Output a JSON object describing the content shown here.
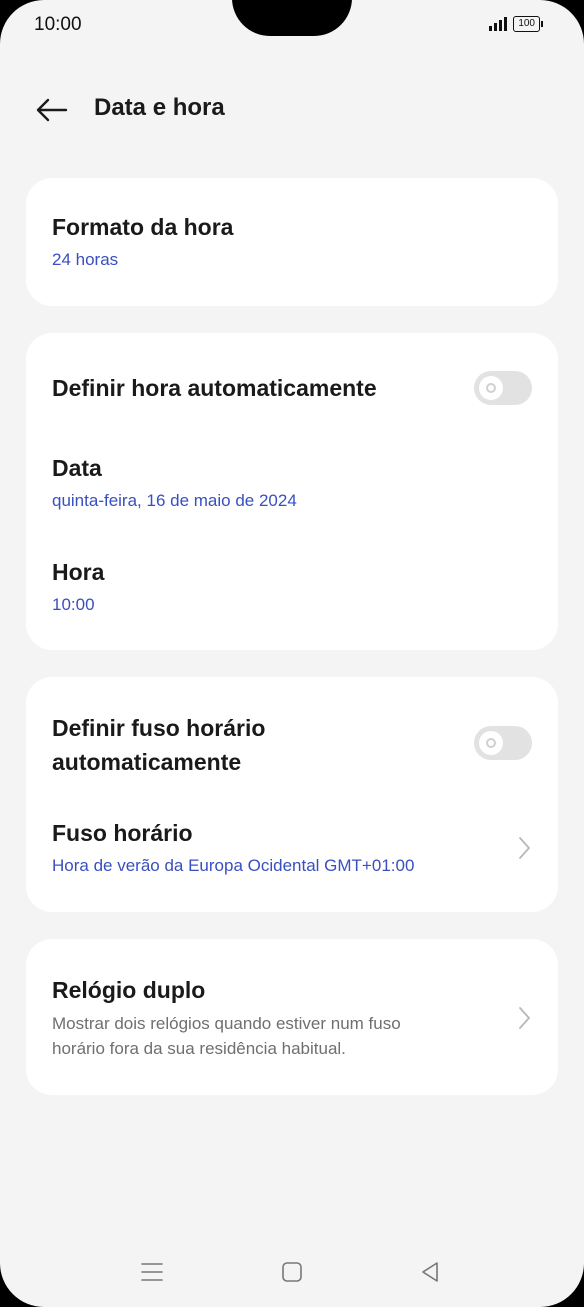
{
  "status_bar": {
    "time": "10:00",
    "battery": "100"
  },
  "header": {
    "title": "Data e hora"
  },
  "card_format": {
    "title": "Formato da hora",
    "value": "24 horas"
  },
  "card_datetime": {
    "auto_time": {
      "label": "Definir hora automaticamente",
      "enabled": false
    },
    "date": {
      "title": "Data",
      "value": "quinta-feira, 16 de maio de 2024"
    },
    "time": {
      "title": "Hora",
      "value": "10:00"
    }
  },
  "card_timezone": {
    "auto_zone": {
      "label_line1": "Definir fuso horário",
      "label_line2": "automaticamente",
      "enabled": false
    },
    "zone": {
      "title": "Fuso horário",
      "value": "Hora de verão da Europa Ocidental GMT+01:00"
    }
  },
  "card_dual_clock": {
    "title": "Relógio duplo",
    "desc_line1": "Mostrar dois relógios quando estiver num fuso",
    "desc_line2": "horário fora da sua residência habitual."
  },
  "icons": {
    "back": "arrow-left-icon",
    "chevron": "chevron-right-icon",
    "nav_menu": "menu-icon",
    "nav_home": "square-icon",
    "nav_back": "triangle-back-icon"
  },
  "colors": {
    "accent_text": "#3a4fbf",
    "background": "#f4f4f4",
    "card": "#ffffff",
    "toggle_off": "#e2e2e2"
  }
}
